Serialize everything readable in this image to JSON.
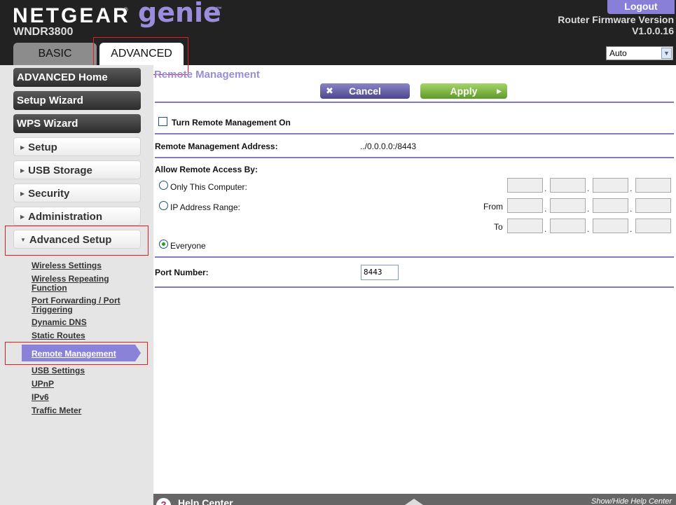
{
  "header": {
    "brand": "NETGEAR",
    "brand_mark": "®",
    "product": "genie",
    "product_mark": "™",
    "model": "WNDR3800",
    "logout_label": "Logout",
    "firmware_label": "Router Firmware Version",
    "firmware_version": "V1.0.0.16",
    "language_select": "Auto",
    "tabs": [
      {
        "label": "BASIC",
        "active": false
      },
      {
        "label": "ADVANCED",
        "active": true
      }
    ]
  },
  "sidebar": {
    "primary": [
      {
        "label": "ADVANCED Home"
      },
      {
        "label": "Setup Wizard"
      },
      {
        "label": "WPS Wizard"
      }
    ],
    "sections": [
      {
        "label": "Setup",
        "expanded": false
      },
      {
        "label": "USB Storage",
        "expanded": false
      },
      {
        "label": "Security",
        "expanded": false
      },
      {
        "label": "Administration",
        "expanded": false
      },
      {
        "label": "Advanced Setup",
        "expanded": true
      }
    ],
    "submenu": [
      {
        "label": "Wireless Settings"
      },
      {
        "label": "Wireless Repeating Function"
      },
      {
        "label": "Port Forwarding / Port Triggering"
      },
      {
        "label": "Dynamic DNS"
      },
      {
        "label": "Static Routes"
      },
      {
        "label": "Remote Management",
        "active": true
      },
      {
        "label": "USB Settings"
      },
      {
        "label": "UPnP"
      },
      {
        "label": "IPv6"
      },
      {
        "label": "Traffic Meter"
      }
    ]
  },
  "main": {
    "title": "Remote Management",
    "cancel_label": "Cancel",
    "apply_label": "Apply",
    "turn_on_label": "Turn Remote Management On",
    "turn_on_checked": false,
    "address_label": "Remote Management Address:",
    "address_value": "../0.0.0.0:/8443",
    "allow_label": "Allow Remote Access By:",
    "options": {
      "only_this": "Only This Computer:",
      "ip_range": "IP Address Range:",
      "everyone": "Everyone",
      "selected": "Everyone"
    },
    "from_label": "From",
    "to_label": "To",
    "port_label": "Port Number:",
    "port_value": "8443"
  },
  "help": {
    "title": "Help Center",
    "toggle_label": "Show/Hide Help Center"
  },
  "colors": {
    "header_bg": "#222222",
    "accent": "#8a82d8",
    "apply_green": "#6aa832",
    "sidebar_bg": "#e5e5e5"
  }
}
